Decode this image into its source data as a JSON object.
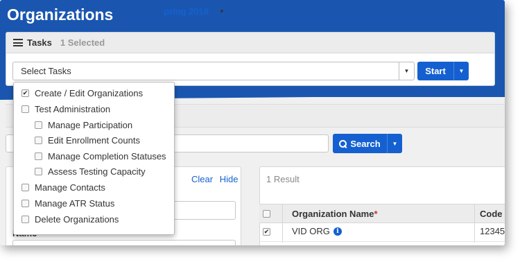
{
  "header": {
    "title": "Organizations"
  },
  "tasks": {
    "label": "Tasks",
    "selected_count": "1 Selected",
    "select_placeholder": "Select Tasks",
    "start_label": "Start"
  },
  "context": {
    "term_label": "pring 2018"
  },
  "search": {
    "button_label": "Search",
    "value": ""
  },
  "filters": {
    "clear_label": "Clear",
    "hide_label": "Hide",
    "name_label": "Name"
  },
  "results": {
    "count_label": "1 Result",
    "columns": [
      "Organization Name",
      "Code"
    ],
    "required_mark": "*",
    "rows": [
      {
        "name": "VID ORG",
        "code": "12345",
        "checked": true
      }
    ]
  },
  "dropdown": {
    "items": [
      {
        "label": "Create / Edit Organizations",
        "checked": true,
        "indent": 0
      },
      {
        "label": "Test Administration",
        "checked": false,
        "indent": 0
      },
      {
        "label": "Manage Participation",
        "checked": false,
        "indent": 1
      },
      {
        "label": "Edit Enrollment Counts",
        "checked": false,
        "indent": 1
      },
      {
        "label": "Manage Completion Statuses",
        "checked": false,
        "indent": 1
      },
      {
        "label": "Assess Testing Capacity",
        "checked": false,
        "indent": 1
      },
      {
        "label": "Manage Contacts",
        "checked": false,
        "indent": 0
      },
      {
        "label": "Manage ATR Status",
        "checked": false,
        "indent": 0
      },
      {
        "label": "Delete Organizations",
        "checked": false,
        "indent": 0
      }
    ]
  },
  "colors": {
    "brand_blue": "#1a56b0",
    "button_blue": "#1560d0",
    "required_red": "#c0392b"
  },
  "icons": {
    "tasks": "list-icon",
    "dropdown_caret": "caret-down-icon",
    "search": "search-icon",
    "info": "info-icon"
  }
}
